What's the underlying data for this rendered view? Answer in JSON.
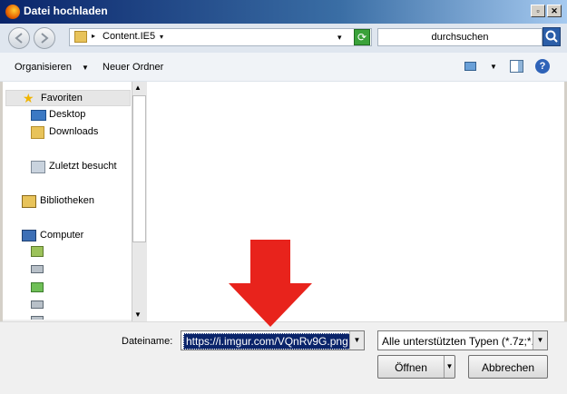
{
  "window": {
    "title": "Datei hochladen"
  },
  "address": {
    "path": "Content.IE5"
  },
  "search": {
    "placeholder": "durchsuchen"
  },
  "toolbar": {
    "organize": "Organisieren",
    "new_folder": "Neuer Ordner"
  },
  "nav": {
    "favorites": "Favoriten",
    "desktop": "Desktop",
    "downloads": "Downloads",
    "recent": "Zuletzt besucht",
    "libraries": "Bibliotheken",
    "computer": "Computer"
  },
  "bottom": {
    "filename_label": "Dateiname:",
    "filename_value": "https://i.imgur.com/VQnRv9G.png",
    "filetype": "Alle unterstützten Typen (*.7z;*.",
    "open": "Öffnen",
    "cancel": "Abbrechen"
  },
  "colors": {
    "annotation_arrow": "#e8231c",
    "selection": "#0a246a"
  }
}
